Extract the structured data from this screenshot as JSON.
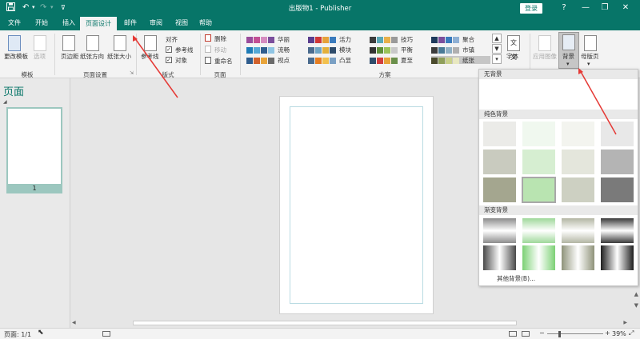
{
  "titlebar": {
    "title": "出版物1  -  Publisher",
    "login_label": "登录",
    "help_label": "?"
  },
  "tabs": [
    "文件",
    "开始",
    "插入",
    "页面设计",
    "邮件",
    "审阅",
    "视图",
    "帮助"
  ],
  "active_tab": "页面设计",
  "ribbon": {
    "groups": {
      "template": "模板",
      "page_setup": "页面设置",
      "layout": "版式",
      "pages": "页面",
      "schemes": "方案"
    },
    "buttons": {
      "change_template": "更改模板",
      "options": "选项",
      "margins": "页边距",
      "orientation": "纸张方向",
      "size": "纸张大小",
      "align": "对齐",
      "guides": "参考线",
      "guides_check": "参考线",
      "objects_check": "对象",
      "delete": "删除",
      "move": "移动",
      "rename": "重命名",
      "fonts": "字体",
      "apply_image": "应用图像",
      "background": "背景",
      "master_pages": "母版页"
    },
    "schemes": [
      {
        "name": "华丽",
        "colors": [
          "#9a4c9c",
          "#c24f94",
          "#d58cc0",
          "#7b4e9c"
        ]
      },
      {
        "name": "流畅",
        "colors": [
          "#1e7bb6",
          "#55a8d6",
          "#2f5d8e",
          "#8fc5e4"
        ]
      },
      {
        "name": "视点",
        "colors": [
          "#2f5d8e",
          "#d1622d",
          "#e8a43a",
          "#6a6a6a"
        ]
      },
      {
        "name": "活力",
        "colors": [
          "#5a3e8e",
          "#d03737",
          "#e6a23a",
          "#3a7bbd"
        ]
      },
      {
        "name": "模块",
        "colors": [
          "#4a6b8e",
          "#6fa5c4",
          "#e3b03b",
          "#2f4c6b"
        ]
      },
      {
        "name": "凸显",
        "colors": [
          "#4a6b8e",
          "#e67e22",
          "#f2c14e",
          "#7aa0c4"
        ]
      },
      {
        "name": "技巧",
        "colors": [
          "#3c3c3c",
          "#5aa8b6",
          "#e8b04a",
          "#9a9a9a"
        ]
      },
      {
        "name": "平衡",
        "colors": [
          "#333333",
          "#5e8f3a",
          "#9bc35a",
          "#c8c8c8"
        ]
      },
      {
        "name": "夏至",
        "colors": [
          "#2f4c6b",
          "#d13d3d",
          "#e8a43a",
          "#6a8f4a"
        ]
      },
      {
        "name": "聚合",
        "colors": [
          "#1e3a5c",
          "#7b4e9c",
          "#3a7bbd",
          "#8fb0d4"
        ]
      },
      {
        "name": "市镇",
        "colors": [
          "#3c3c3c",
          "#4a7a96",
          "#8fb0c4",
          "#b0b0b0"
        ]
      },
      {
        "name": "纸张",
        "colors": [
          "#4a4a2c",
          "#8f9f5a",
          "#c8d08a",
          "#e8e8c0"
        ]
      }
    ],
    "selected_scheme": "纸张"
  },
  "pages_panel": {
    "title": "页面",
    "page_number": "1"
  },
  "background_menu": {
    "no_background": "无背景",
    "solid_header": "纯色背景",
    "gradient_header": "渐变背景",
    "more": "其他背景(B)...",
    "solid_colors": [
      "#ebebe8",
      "#f0f8ef",
      "#f3f4ef",
      "#e8e8e8",
      "#c9cbbf",
      "#d6eed1",
      "#e4e6dc",
      "#b4b4b4",
      "#a4a68f",
      "#b9e4b1",
      "#cdd0c2",
      "#7a7a7a"
    ],
    "selected_solid": "#b9e4b1",
    "gradient_rows": [
      [
        "#8c8c8c",
        "#9fd89a",
        "#b3b6a3",
        "#3a3a3a"
      ],
      [
        "#4a4a4a",
        "#7cd175",
        "#8f937a",
        "#1e1e1e"
      ]
    ]
  },
  "status": {
    "page": "页面: 1/1",
    "zoom": "39%"
  }
}
